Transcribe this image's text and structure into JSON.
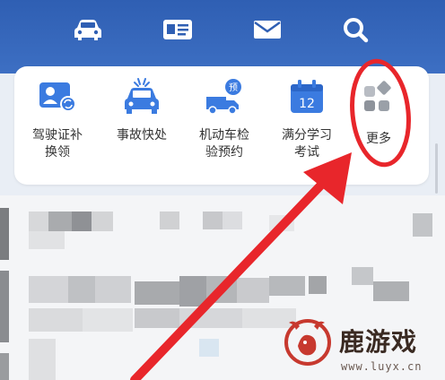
{
  "header": {
    "icons": [
      "car-icon",
      "license-card-icon",
      "mail-icon",
      "search-icon"
    ]
  },
  "services": [
    {
      "label_line1": "驾驶证补",
      "label_line2": "换领",
      "icon": "license-renew-icon"
    },
    {
      "label_line1": "事故快处",
      "label_line2": "",
      "icon": "accident-car-icon"
    },
    {
      "label_line1": "机动车检",
      "label_line2": "验预约",
      "icon": "inspection-truck-icon"
    },
    {
      "label_line1": "满分学习",
      "label_line2": "考试",
      "icon": "calendar-exam-icon",
      "badge": "12"
    },
    {
      "label_line1": "更多",
      "label_line2": "",
      "icon": "more-grid-icon"
    }
  ],
  "watermark": {
    "text": "鹿游戏",
    "url": "www.luyx.cn"
  },
  "colors": {
    "header_blue": "#2f5fb3",
    "icon_blue": "#3b7be0",
    "annotation_red": "#e8262b"
  }
}
